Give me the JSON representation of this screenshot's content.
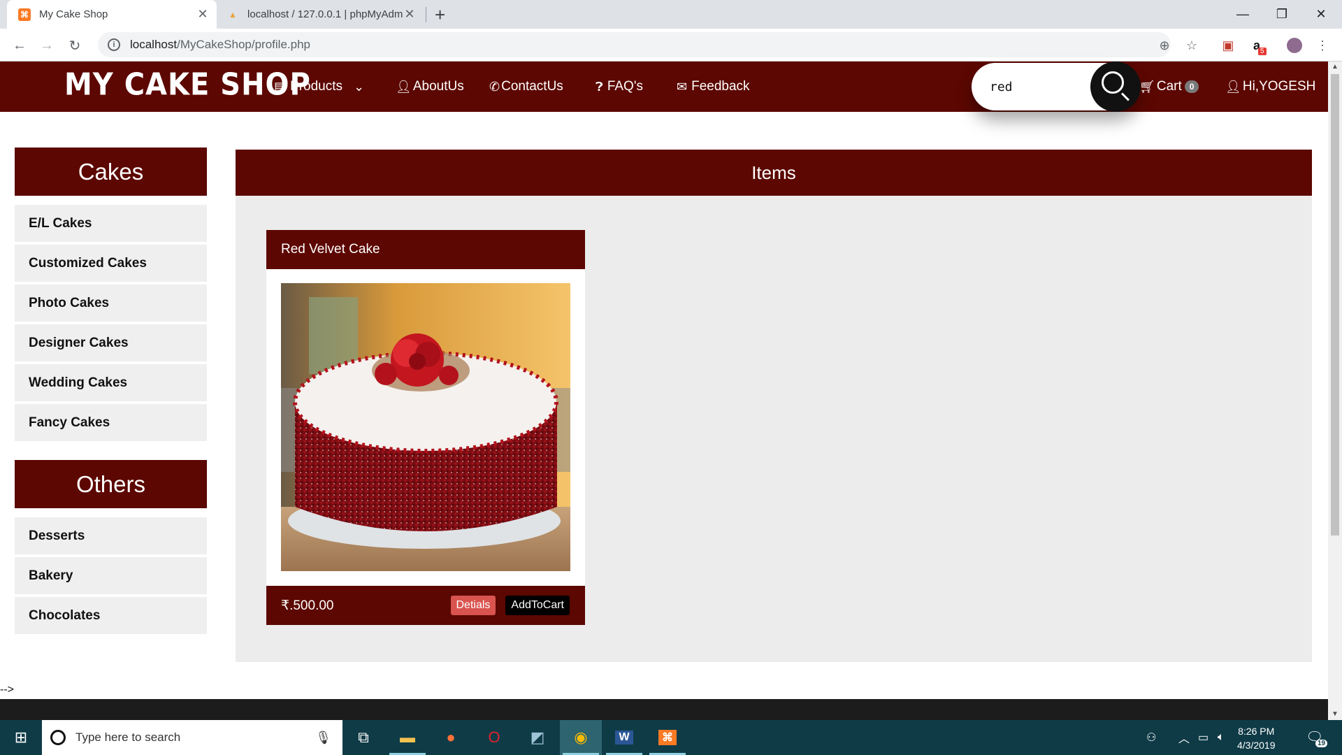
{
  "browser": {
    "tabs": [
      {
        "title": "My Cake Shop",
        "active": true
      },
      {
        "title": "localhost / 127.0.0.1 | phpMyAdm",
        "active": false
      }
    ],
    "url_host": "localhost",
    "url_path": "/MyCakeShop/profile.php",
    "extension_badge": "5"
  },
  "header": {
    "logo": "MY CAKE SHOP",
    "nav": {
      "products": "Products",
      "about": "AboutUs",
      "contact": "ContactUs",
      "faq": "FAQ's",
      "feedback": "Feedback"
    },
    "search_value": "red",
    "cart_label": "Cart",
    "cart_count": "0",
    "user_greeting": "Hi,YOGESH"
  },
  "sidebar": {
    "cakes_heading": "Cakes",
    "cakes": [
      "E/L Cakes",
      "Customized Cakes",
      "Photo Cakes",
      "Designer Cakes",
      "Wedding Cakes",
      "Fancy Cakes"
    ],
    "others_heading": "Others",
    "others": [
      "Desserts",
      "Bakery",
      "Chocolates"
    ]
  },
  "main": {
    "heading": "Items",
    "product": {
      "name": "Red Velvet Cake",
      "price": "₹.500.00",
      "details_label": "Detials",
      "add_label": "AddToCart"
    }
  },
  "stray_text": "-->",
  "taskbar": {
    "search_placeholder": "Type here to search",
    "time": "8:26 PM",
    "date": "4/3/2019",
    "notification_count": "19"
  },
  "colors": {
    "brand": "#5c0701",
    "details_button": "#d9534f",
    "taskbar": "#0f3b47"
  }
}
